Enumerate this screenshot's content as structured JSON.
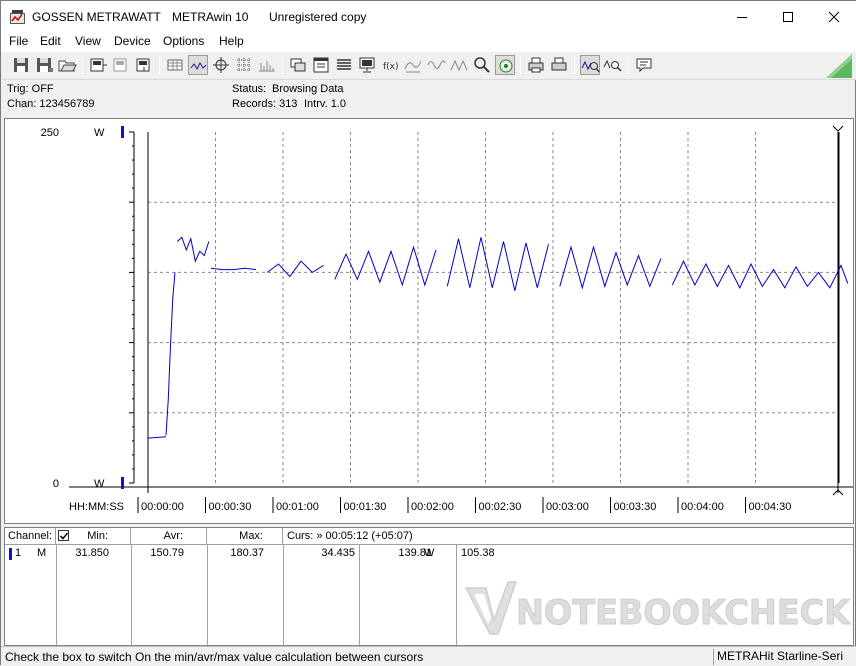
{
  "window": {
    "brand": "GOSSEN METRAWATT",
    "app": "METRAwin 10",
    "license": "Unregistered copy"
  },
  "menu": [
    "File",
    "Edit",
    "View",
    "Device",
    "Options",
    "Help"
  ],
  "status": {
    "trig": "Trig: OFF",
    "chan": "Chan:  123456789",
    "status_label": "Status:",
    "status_value": "Browsing Data",
    "records": "Records: 313",
    "intrv": "Intrv. 1.0"
  },
  "chart_data": {
    "type": "line",
    "unit": "W",
    "ylim": [
      0,
      250
    ],
    "y_tick_labels": [
      "250",
      "0"
    ],
    "x_axis_label": "HH:MM:SS",
    "x_tick_labels": [
      "00:00:00",
      "00:00:30",
      "00:01:00",
      "00:01:30",
      "00:02:00",
      "00:02:30",
      "00:03:00",
      "00:03:30",
      "00:04:00",
      "00:04:30"
    ],
    "x_interval_s": 1,
    "grid": true,
    "series_color": "#0000cc",
    "segments": [
      {
        "x": [
          0,
          8
        ],
        "y": [
          32,
          33
        ]
      },
      {
        "x": [
          8,
          9,
          10,
          11,
          12
        ],
        "y": [
          34,
          60,
          98,
          132,
          150
        ]
      },
      {
        "x": [
          13,
          15,
          17,
          19,
          21,
          23,
          25,
          27
        ],
        "y": [
          172,
          175,
          166,
          174,
          158,
          165,
          162,
          172
        ]
      },
      {
        "x": [
          28,
          33,
          38,
          43,
          48
        ],
        "y": [
          153,
          152,
          152,
          153,
          152
        ]
      },
      {
        "x": [
          53,
          58,
          63,
          68,
          73,
          78
        ],
        "y": [
          150,
          156,
          147,
          158,
          150,
          155
        ]
      },
      {
        "x": [
          83,
          88,
          93,
          98,
          103,
          108,
          113,
          118,
          123,
          128
        ],
        "y": [
          145,
          163,
          145,
          165,
          143,
          165,
          141,
          168,
          141,
          166
        ]
      },
      {
        "x": [
          133,
          138,
          143,
          148,
          153,
          158,
          163,
          168,
          173,
          178
        ],
        "y": [
          140,
          174,
          139,
          175,
          139,
          172,
          137,
          171,
          139,
          170
        ]
      },
      {
        "x": [
          183,
          188,
          193,
          198,
          203,
          208,
          213,
          218,
          223,
          228
        ],
        "y": [
          140,
          168,
          139,
          168,
          140,
          164,
          141,
          162,
          140,
          160
        ]
      },
      {
        "x": [
          233,
          238,
          243,
          248,
          253,
          258,
          263,
          268,
          273,
          278,
          283,
          288,
          293,
          298,
          303,
          308,
          311
        ],
        "y": [
          141,
          158,
          141,
          156,
          140,
          155,
          139,
          156,
          140,
          152,
          139,
          154,
          140,
          150,
          139,
          155,
          142
        ]
      }
    ]
  },
  "table": {
    "headers": {
      "channel": "Channel:",
      "min": "Min:",
      "avr": "Avr:",
      "max": "Max:",
      "curs": "Curs: » 00:05:12 (+05:07)"
    },
    "row": {
      "num": "1",
      "mode": "M",
      "min": "31.850",
      "avr": "150.79",
      "max": "180.37",
      "cursor_value": "34.435",
      "cursor_power": "139.81",
      "unit": "W",
      "delta": "105.38"
    }
  },
  "watermark": "NOTEBOOKCHECK",
  "statusbar": {
    "hint": "Check the box to switch On the min/avr/max value calculation between cursors",
    "device": "METRAHit Starline-Seri"
  }
}
